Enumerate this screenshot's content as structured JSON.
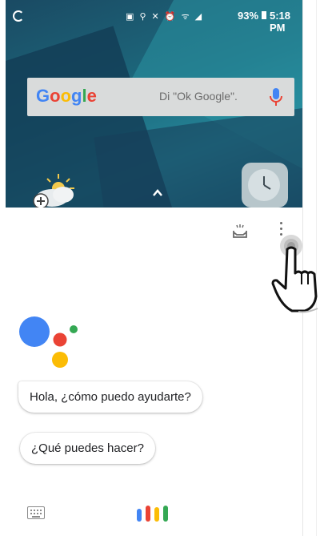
{
  "status_bar": {
    "icons_label": "▣ ⚲ ✕ ⏰ ᯤ ◢",
    "battery_percent": "93%",
    "time": "5:18 PM"
  },
  "search_widget": {
    "logo_letters": [
      "G",
      "o",
      "o",
      "g",
      "l",
      "e"
    ],
    "hint": "Di \"Ok Google\"."
  },
  "assistant": {
    "greeting": "Hola, ¿cómo puedo ayudarte?",
    "suggestion": "¿Qué puedes hacer?"
  },
  "colors": {
    "google_blue": "#4285f4",
    "google_red": "#ea4335",
    "google_yellow": "#fbbc05",
    "google_green": "#34a853"
  }
}
